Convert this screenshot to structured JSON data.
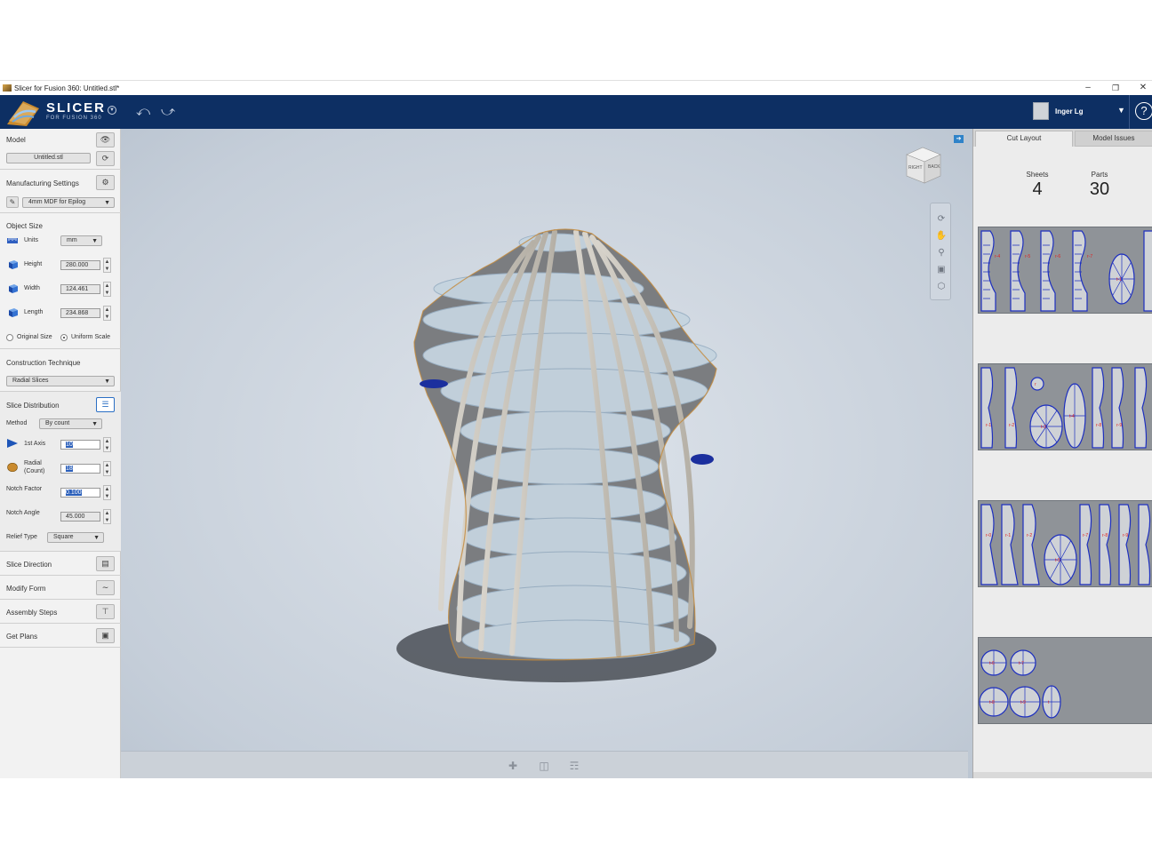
{
  "window": {
    "title": "Slicer for Fusion 360: Untitled.stl*",
    "minimize": "–",
    "restore": "❐",
    "close": "✕"
  },
  "header": {
    "logo_title": "SLICER",
    "logo_subtitle": "FOR FUSION 360",
    "user_name": "Inger Lg",
    "help": "?"
  },
  "left": {
    "model": {
      "title": "Model",
      "file": "Untitled.stl"
    },
    "manufacturing": {
      "title": "Manufacturing Settings",
      "material": "4mm MDF for Epilog"
    },
    "object_size": {
      "title": "Object Size",
      "units_label": "Units",
      "units_value": "mm",
      "height_label": "Height",
      "height_value": "280.000",
      "width_label": "Width",
      "width_value": "124.461",
      "length_label": "Length",
      "length_value": "234.868",
      "original_size": "Original Size",
      "uniform_scale": "Uniform Scale"
    },
    "construction": {
      "title": "Construction Technique",
      "value": "Radial Slices"
    },
    "slice_distribution": {
      "title": "Slice Distribution",
      "method_label": "Method",
      "method_value": "By count",
      "axis_label": "1st Axis",
      "axis_value": "10",
      "radial_label": "Radial",
      "radial_sub": "(Count)",
      "radial_value": "18",
      "notch_factor_label": "Notch Factor",
      "notch_factor_value": "0.100",
      "notch_angle_label": "Notch Angle",
      "notch_angle_value": "45.000",
      "relief_label": "Relief Type",
      "relief_value": "Square"
    },
    "slice_direction": "Slice Direction",
    "modify_form": "Modify Form",
    "assembly_steps": "Assembly Steps",
    "get_plans": "Get Plans"
  },
  "viewcube": {
    "right": "RIGHT",
    "back": "BACK"
  },
  "right": {
    "tab_cut_layout": "Cut Layout",
    "tab_model_issues": "Model Issues",
    "sheets_label": "Sheets",
    "sheets_value": "4",
    "parts_label": "Parts",
    "parts_value": "30"
  },
  "colors": {
    "header_bg": "#0d2f63",
    "sheet_bg": "#8f9398",
    "part_outline": "#1d2fbf",
    "part_label": "#e02020"
  }
}
